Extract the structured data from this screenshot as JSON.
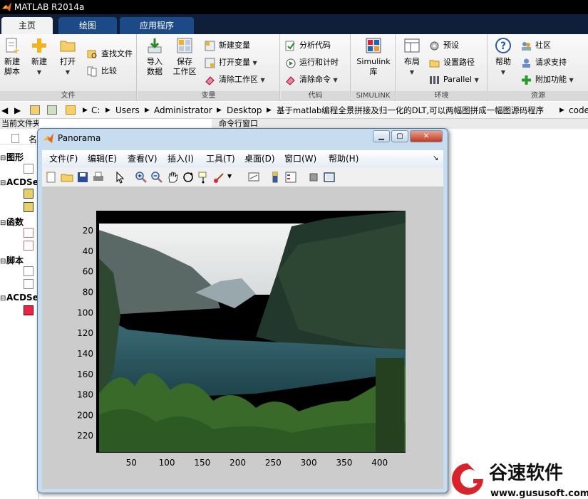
{
  "app": {
    "title": "MATLAB R2014a"
  },
  "tabs": [
    {
      "label": "主页",
      "active": true
    },
    {
      "label": "绘图",
      "active": false
    },
    {
      "label": "应用程序",
      "active": false
    }
  ],
  "ribbon": {
    "groups": [
      {
        "label": "文件"
      },
      {
        "label": "变量"
      },
      {
        "label": "代码"
      },
      {
        "label": "SIMULINK"
      },
      {
        "label": "环境"
      },
      {
        "label": "资源"
      }
    ],
    "file": {
      "new_script": [
        "新建",
        "脚本"
      ],
      "new": "新建",
      "open": "打开",
      "find_files": "查找文件",
      "compare": "比较"
    },
    "variable": {
      "import": [
        "导入",
        "数据"
      ],
      "save_ws": [
        "保存",
        "工作区"
      ],
      "new_var": "新建变量",
      "open_var": "打开变量",
      "clear_ws": "清除工作区"
    },
    "code": {
      "analyze": "分析代码",
      "run_time": "运行和计时",
      "clear_cmd": "清除命令"
    },
    "simulink": {
      "lib": [
        "Simulink",
        "库"
      ]
    },
    "env": {
      "layout": "布局",
      "prefs": "预设",
      "set_path": "设置路径",
      "parallel": "Parallel"
    },
    "resources": {
      "help": "帮助",
      "community": "社区",
      "support": "请求支持",
      "addons": "附加功能"
    }
  },
  "address": {
    "crumbs": [
      "C:",
      "Users",
      "Administrator",
      "Desktop",
      "基于matlab编程全景拼接及归一化的DLT,可以两幅图拼成一幅图源码程序",
      "code"
    ]
  },
  "left_panel": {
    "header": "当前文件夹",
    "name_col": "名",
    "groups": [
      "图形",
      "ACDSe",
      "函数",
      "脚本",
      "ACDSe"
    ]
  },
  "command_window": {
    "header": "命令行窗口"
  },
  "figure": {
    "title": "Panorama",
    "menu": [
      "文件(F)",
      "编辑(E)",
      "查看(V)",
      "插入(I)",
      "工具(T)",
      "桌面(D)",
      "窗口(W)",
      "帮助(H)"
    ]
  },
  "chart_data": {
    "type": "image",
    "title": "",
    "xlabel": "",
    "ylabel": "",
    "xticks": [
      50,
      100,
      150,
      200,
      250,
      300,
      350,
      400
    ],
    "yticks": [
      20,
      40,
      60,
      80,
      100,
      120,
      140,
      160,
      180,
      200,
      220
    ],
    "xlim": [
      0.5,
      436.5
    ],
    "ylim": [
      0.5,
      236.5
    ],
    "y_reversed": true
  },
  "watermark": {
    "brand": "谷速软件",
    "url": "www.gususoft.com"
  },
  "colors": {
    "accent": "#1b4a86",
    "ribbon_bg": "#eeeeee",
    "figure_frame": "#c8dcf0"
  }
}
